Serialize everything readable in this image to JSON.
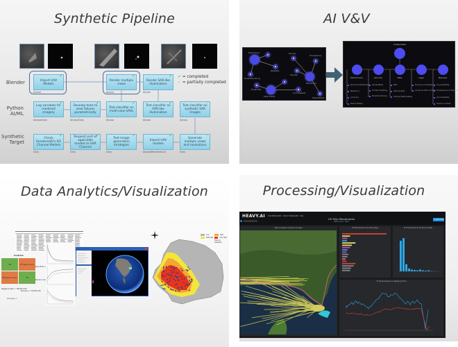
{
  "slides": [
    {
      "title": "Synthetic Pipeline",
      "rows": [
        "Blender",
        "Python\nAI/ML",
        "Synthetic\nTarget"
      ],
      "legend": [
        {
          "mark": "✓",
          "status": "completed",
          "label": "= completed",
          "color": "#2ca24a"
        },
        {
          "mark": "✓",
          "status": "partial",
          "label": "= partially completed",
          "color": "#e8a64a"
        }
      ],
      "boxes": [
        {
          "label": "Import UAV Models",
          "owner": "Alyssa",
          "status": "done"
        },
        {
          "label": "Render multiple views",
          "owner": "Alyssa",
          "status": "done"
        },
        {
          "label": "Render SAR-like illumination",
          "owner": "Alyssa",
          "status": "done"
        },
        {
          "label": "Log variables for rendered imagery",
          "owner": "Alyssa/Gary",
          "status": "done"
        },
        {
          "label": "Develop tools to view failures parametrically",
          "owner": "Alyssa/Gary",
          "status": "done"
        },
        {
          "label": "Test classifier on multi-view UAVs",
          "owner": "Alyssa",
          "status": "done"
        },
        {
          "label": "Test classifier on SAR-like illumination",
          "owner": "Alyssa",
          "status": "done"
        },
        {
          "label": "Test classifier on synthetic SAR images",
          "owner": "Alyssa",
          "status": "partial"
        },
        {
          "label": "Check RenderedAI's EO Channel Models",
          "owner": "Gary",
          "status": "done"
        },
        {
          "label": "Request port of applicable models to SAR Channel",
          "owner": "Gary",
          "status": "done"
        },
        {
          "label": "Test image generation strategies",
          "owner": "Gary",
          "status": "done"
        },
        {
          "label": "Import UAV models",
          "owner": "Alyssa/Rendered.AI",
          "status": "done"
        },
        {
          "label": "Generate multiple views and resolutions",
          "owner": "Gary",
          "status": "partial"
        }
      ]
    },
    {
      "title": "AI V&V",
      "graph_labels": [
        "Performance",
        "Reliability",
        "Model Monitoring",
        "Security",
        "Fairness",
        "Transparency",
        "Robustness",
        "Explainability",
        "Data Quality",
        "Model Drift",
        "Accountability"
      ],
      "taxonomy": {
        "root": "Components",
        "categories": [
          {
            "name": "Performance",
            "items": [
              "Technical Robustness",
              "Resiliency",
              "Accuracy",
              "Stress testing"
            ]
          },
          {
            "name": "Security",
            "items": [
              "Vulnerability",
              "Threat modelling",
              "Model hardening"
            ]
          },
          {
            "name": "Data",
            "items": [
              "Bias",
              "Data Quality",
              "Training Data testing"
            ]
          },
          {
            "name": "Legal",
            "items": [
              "Privacy & Compliance",
              "Access & data controls"
            ]
          },
          {
            "name": "Business",
            "items": [
              "Accountability",
              "Transparency & Explainability",
              "Accountability",
              "Human controls"
            ]
          }
        ]
      }
    },
    {
      "title": "Data Analytics/Visualization",
      "confusion": {
        "header": "Predicted",
        "cells": [
          "TN",
          "FP Type I error",
          "FN Type II error",
          "TP"
        ],
        "notes": [
          "Negative Rate = TN/(TN+FN)",
          "Precision = TP/(TP+FP)",
          "Accuracy =",
          "Specificity =",
          "Recall or Sensitivity ="
        ]
      },
      "map_legend": [
        "Low",
        "High",
        "Moderate",
        "Very High",
        "Training",
        "Validation"
      ]
    },
    {
      "title": "Processing/Visualization",
      "dashboard": {
        "brand": "HEAVY.AI",
        "nav": [
          "DASHBOARDS",
          "DATA MANAGER",
          "SQL"
        ],
        "title": "US Ship Movements",
        "subtitle": "Data source · Filter",
        "add_button": "+ Add Chart",
        "panels": [
          "Ship Locations Colored by Type",
          "# Transmissions by Ship Type",
          "# Transmissions by Ship Length",
          "# Transmissions & Shipping Time"
        ]
      }
    }
  ],
  "colors": {
    "box_fill": "#8fd1e8",
    "group_outline": "#4d6d9c",
    "node_blue": "#4c4cf0",
    "arrow": "#3e6373",
    "heat_red": "#e8341c",
    "heat_yellow": "#f4e53a",
    "bar_blue": "#2ea6e8",
    "line_red": "#d6433a"
  }
}
